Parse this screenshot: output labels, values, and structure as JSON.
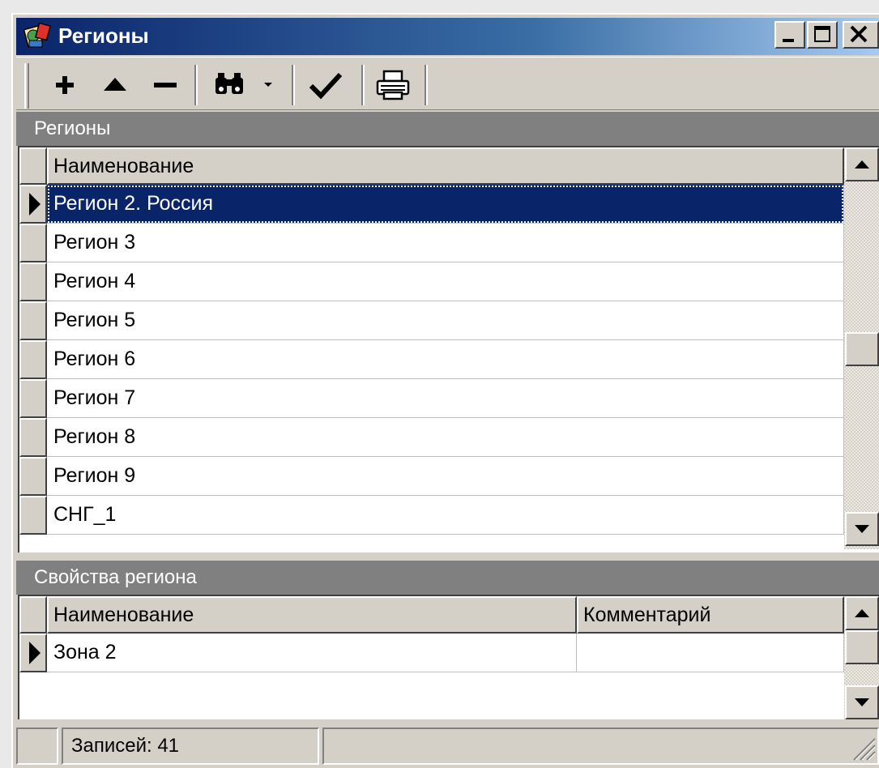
{
  "window": {
    "title": "Регионы",
    "icons": [
      "app-icon",
      "minimize-icon",
      "maximize-icon",
      "close-icon"
    ]
  },
  "toolbar": {
    "buttons": [
      {
        "name": "add-button",
        "icon": "plus-icon"
      },
      {
        "name": "move-up-button",
        "icon": "triangle-up-icon"
      },
      {
        "name": "delete-button",
        "icon": "minus-icon"
      },
      {
        "name": "find-button",
        "icon": "binoculars-icon"
      },
      {
        "name": "find-dropdown-button",
        "icon": "dropdown-arrow-icon"
      },
      {
        "name": "apply-button",
        "icon": "checkmark-icon"
      },
      {
        "name": "print-button",
        "icon": "printer-icon"
      }
    ]
  },
  "regions": {
    "section_title": "Регионы",
    "columns": [
      "Наименование"
    ],
    "rows": [
      "Регион 2. Россия",
      "Регион 3",
      "Регион 4",
      "Регион 5",
      "Регион 6",
      "Регион 7",
      "Регион 8",
      "Регион 9",
      "СНГ_1"
    ],
    "selected_index": 0
  },
  "properties": {
    "section_title": "Свойства региона",
    "columns": [
      "Наименование",
      "Комментарий"
    ],
    "rows": [
      {
        "name": "Зона 2",
        "comment": ""
      }
    ]
  },
  "status": {
    "records": "Записей: 41"
  }
}
